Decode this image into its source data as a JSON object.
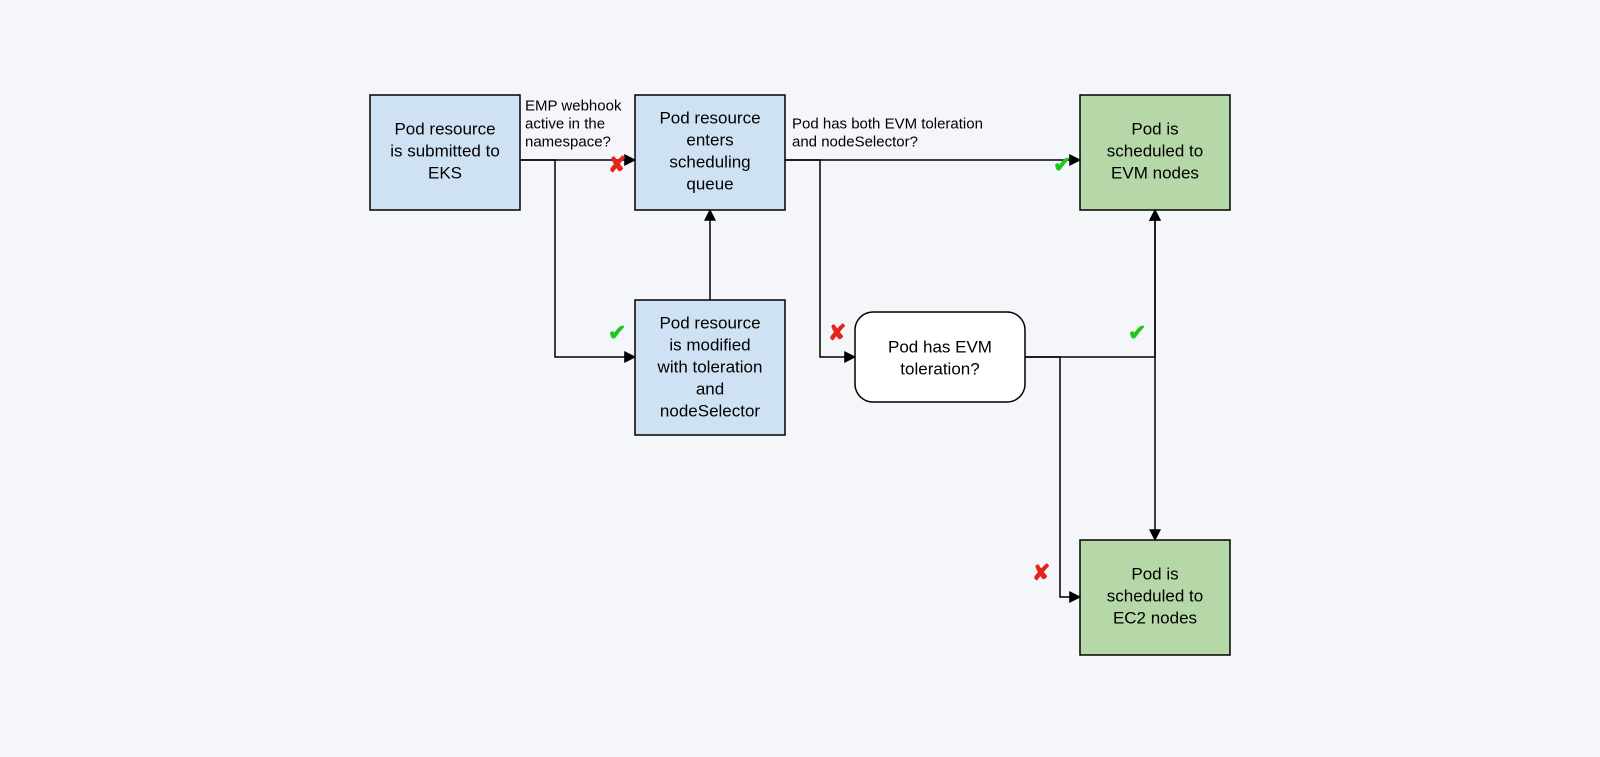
{
  "nodes": {
    "submit": {
      "l1": "Pod resource",
      "l2": "is submitted to",
      "l3": "EKS"
    },
    "queue": {
      "l1": "Pod resource",
      "l2": "enters",
      "l3": "scheduling",
      "l4": "queue"
    },
    "modify": {
      "l1": "Pod resource",
      "l2": "is modified",
      "l3": "with toleration",
      "l4": "and",
      "l5": "nodeSelector"
    },
    "evm": {
      "l1": "Pod is",
      "l2": "scheduled to",
      "l3": "EVM nodes"
    },
    "ec2": {
      "l1": "Pod is",
      "l2": "scheduled to",
      "l3": "EC2 nodes"
    },
    "hastol": {
      "l1": "Pod has EVM",
      "l2": "toleration?"
    }
  },
  "labels": {
    "webhook1": "EMP webhook",
    "webhook2": "active in the",
    "webhook3": "namespace?",
    "both1": "Pod has both EVM toleration",
    "both2": "and nodeSelector?"
  },
  "marks": {
    "check": "✔",
    "cross": "✘"
  }
}
